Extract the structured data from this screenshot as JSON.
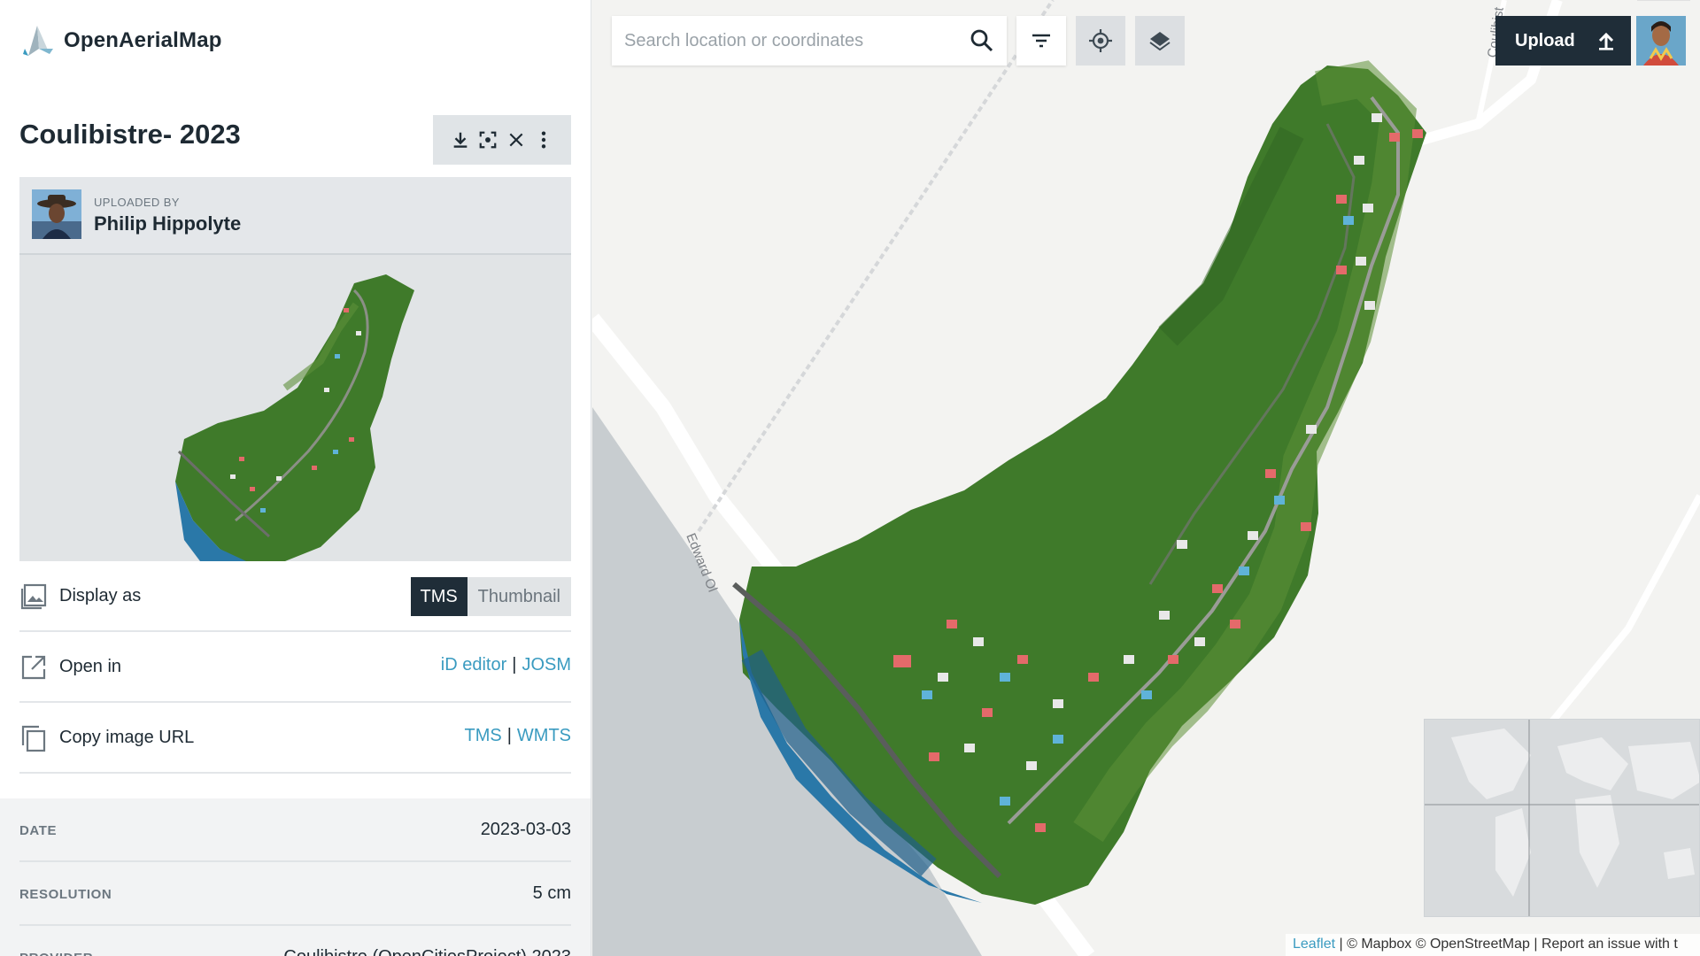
{
  "app": {
    "name": "OpenAerialMap"
  },
  "image": {
    "title": "Coulibistre- 2023"
  },
  "uploader": {
    "label": "UPLOADED BY",
    "name": "Philip Hippolyte"
  },
  "display": {
    "label": "Display as",
    "options": [
      "TMS",
      "Thumbnail"
    ],
    "selected": "TMS"
  },
  "open_in": {
    "label": "Open in",
    "links": [
      "iD editor",
      "JOSM"
    ],
    "separator": "|"
  },
  "copy_url": {
    "label": "Copy image URL",
    "links": [
      "TMS",
      "WMTS"
    ],
    "separator": "|"
  },
  "meta": [
    {
      "key": "DATE",
      "value": "2023-03-03"
    },
    {
      "key": "RESOLUTION",
      "value": "5 cm"
    },
    {
      "key": "PROVIDER",
      "value": "Coulibistre (OpenCitiesProject) 2023"
    }
  ],
  "search": {
    "placeholder": "Search location or coordinates",
    "value": ""
  },
  "toolbar": {
    "upload_label": "Upload"
  },
  "map": {
    "road_label_1": "Edward Ol",
    "road_label_2": "Coulibist",
    "attribution": {
      "leaflet": "Leaflet",
      "sep": "|",
      "mapbox": "© Mapbox",
      "osm": "© OpenStreetMap",
      "report": "Report an issue with t"
    }
  },
  "colors": {
    "dark": "#1f2d38",
    "link": "#3a9bc0",
    "vegetation": "#3f7a2a",
    "sea": "#2a78a8"
  },
  "icons": [
    "download-icon",
    "zoom-to-extent-icon",
    "close-icon",
    "more-vert-icon",
    "image-icon",
    "external-link-icon",
    "copy-icon",
    "search-icon",
    "filter-icon",
    "locate-icon",
    "layers-icon",
    "upload-icon"
  ]
}
